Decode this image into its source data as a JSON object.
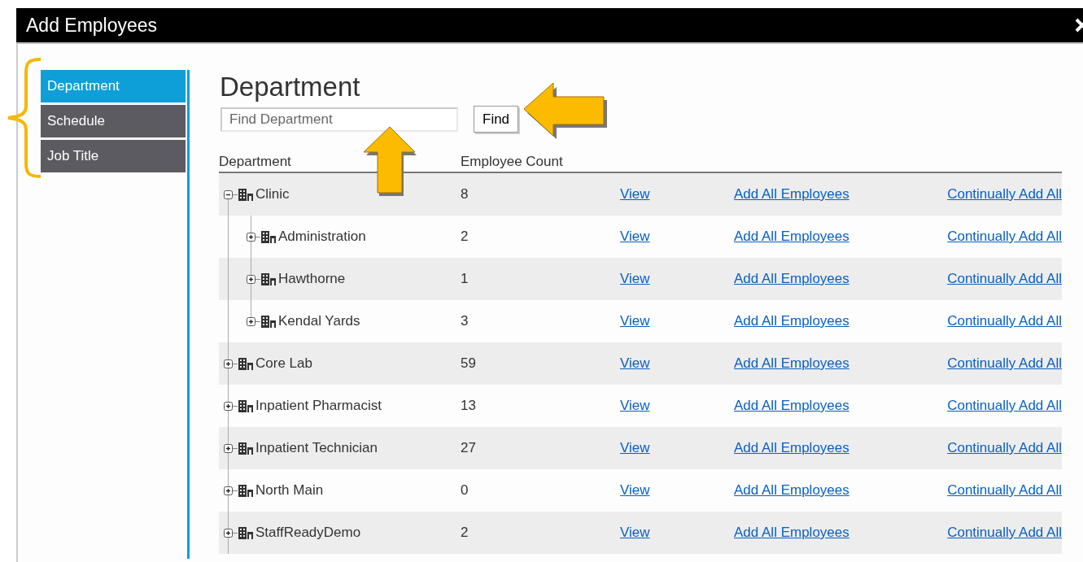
{
  "window": {
    "title": "Add Employees"
  },
  "sidebar": {
    "items": [
      {
        "label": "Department",
        "selected": true
      },
      {
        "label": "Schedule",
        "selected": false
      },
      {
        "label": "Job Title",
        "selected": false
      }
    ]
  },
  "heading": "Department",
  "search": {
    "placeholder": "Find Department",
    "button": "Find"
  },
  "table": {
    "columns": [
      "Department",
      "Employee Count"
    ],
    "rows": [
      {
        "name": "Clinic",
        "count": "8",
        "expanded": true,
        "actions": [
          "View",
          "Add All Employees",
          "Continually Add All"
        ],
        "children": [
          {
            "name": "Administration",
            "count": "2",
            "expanded": false,
            "actions": [
              "View",
              "Add All Employees",
              "Continually Add All"
            ]
          },
          {
            "name": "Hawthorne",
            "count": "1",
            "expanded": false,
            "actions": [
              "View",
              "Add All Employees",
              "Continually Add All"
            ]
          },
          {
            "name": "Kendal Yards",
            "count": "3",
            "expanded": false,
            "actions": [
              "View",
              "Add All Employees",
              "Continually Add All"
            ]
          }
        ]
      },
      {
        "name": "Core Lab",
        "count": "59",
        "expanded": false,
        "actions": [
          "View",
          "Add All Employees",
          "Continually Add All"
        ]
      },
      {
        "name": "Inpatient Pharmacist",
        "count": "13",
        "expanded": false,
        "actions": [
          "View",
          "Add All Employees",
          "Continually Add All"
        ]
      },
      {
        "name": "Inpatient Technician",
        "count": "27",
        "expanded": false,
        "actions": [
          "View",
          "Add All Employees",
          "Continually Add All"
        ]
      },
      {
        "name": "North Main",
        "count": "0",
        "expanded": false,
        "actions": [
          "View",
          "Add All Employees",
          "Continually Add All"
        ]
      },
      {
        "name": "StaffReadyDemo",
        "count": "2",
        "expanded": false,
        "actions": [
          "View",
          "Add All Employees",
          "Continually Add All"
        ]
      }
    ]
  }
}
